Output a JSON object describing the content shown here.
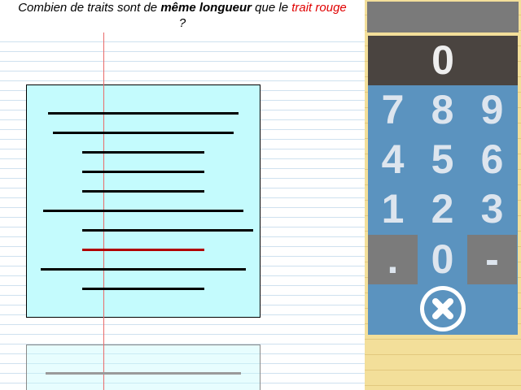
{
  "question": {
    "part1": "Combien de traits sont de ",
    "bold": "même longueur",
    "part2": " que le ",
    "red": "trait rouge",
    "part3": " ?"
  },
  "keypad": {
    "display": "0",
    "keys": [
      "7",
      "8",
      "9",
      "4",
      "5",
      "6",
      "1",
      "2",
      "3",
      ".",
      "0",
      "-"
    ],
    "clear_icon": "close-circle-icon"
  },
  "colors": {
    "accent_red": "#e00000",
    "keypad_blue": "#5b93bf",
    "card_cyan": "#c4fbfd"
  }
}
